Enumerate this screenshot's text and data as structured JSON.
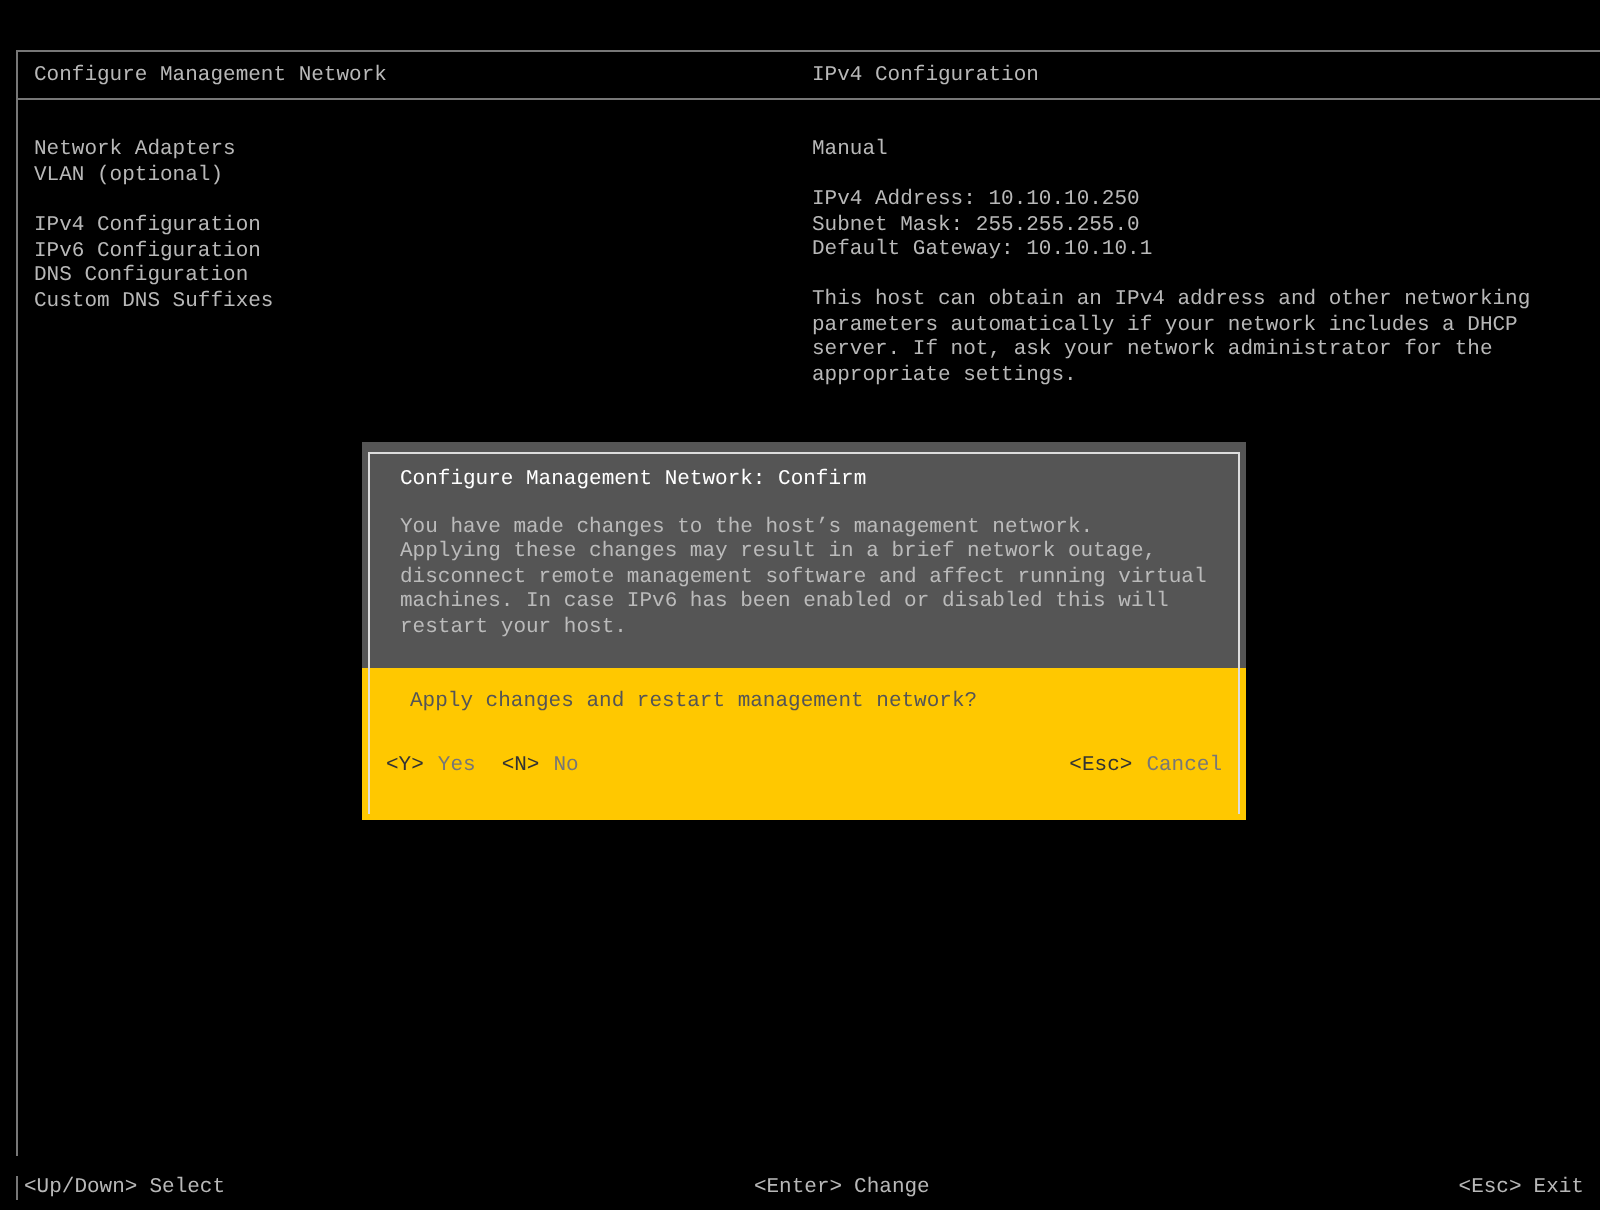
{
  "header": {
    "left_title": "Configure Management Network",
    "right_title": "IPv4 Configuration"
  },
  "menu_groups": [
    {
      "items": [
        "Network Adapters",
        "VLAN (optional)"
      ]
    },
    {
      "items": [
        "IPv4 Configuration",
        "IPv6 Configuration",
        "DNS Configuration",
        "Custom DNS Suffixes"
      ]
    }
  ],
  "detail": {
    "mode": "Manual",
    "fields": [
      "IPv4 Address: 10.10.10.250",
      "Subnet Mask: 255.255.255.0",
      "Default Gateway: 10.10.10.1"
    ],
    "note": "This host can obtain an IPv4 address and other networking parameters automatically if your network includes a DHCP server. If not, ask your network administrator for the appropriate settings."
  },
  "dialog": {
    "title": "Configure Management Network: Confirm",
    "message": "You have made changes to the host’s management network.\nApplying these changes may result in a brief network outage,\ndisconnect remote management software and affect running virtual\nmachines. In case IPv6 has been enabled or disabled this will\nrestart your host.",
    "question": "Apply changes and restart management network?",
    "left_actions": [
      {
        "key": "<Y>",
        "label": "Yes"
      },
      {
        "key": "<N>",
        "label": "No"
      }
    ],
    "right_actions": [
      {
        "key": "<Esc>",
        "label": "Cancel"
      }
    ]
  },
  "footer": [
    {
      "key": "<Up/Down>",
      "label": "Select"
    },
    {
      "key": "<Enter>",
      "label": "Change"
    },
    {
      "key": "<Esc>",
      "label": "Exit"
    }
  ]
}
